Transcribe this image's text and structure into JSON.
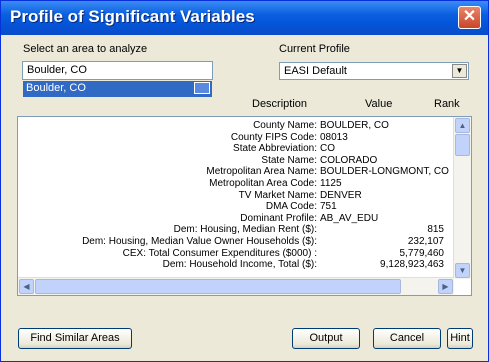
{
  "window": {
    "title": "Profile of Significant Variables"
  },
  "area": {
    "label": "Select an area to analyze",
    "input_value": "Boulder, CO",
    "selected_item": "Boulder, CO"
  },
  "profile": {
    "label": "Current Profile",
    "selected": "EASI Default"
  },
  "table": {
    "headers": {
      "description": "Description",
      "value": "Value",
      "rank": "Rank"
    },
    "rows": [
      {
        "description": "County Name:",
        "value": "BOULDER, CO"
      },
      {
        "description": "County FIPS Code:",
        "value": "08013"
      },
      {
        "description": "State Abbreviation:",
        "value": "CO"
      },
      {
        "description": "State Name:",
        "value": "COLORADO"
      },
      {
        "description": "Metropolitan Area Name:",
        "value": "BOULDER-LONGMONT, CO"
      },
      {
        "description": "Metropolitan Area Code:",
        "value": "1125"
      },
      {
        "description": "TV Market Name:",
        "value": "DENVER"
      },
      {
        "description": "DMA Code:",
        "value": "751"
      },
      {
        "description": "Dominant Profile:",
        "value": "AB_AV_EDU"
      },
      {
        "description": "Dem: Housing, Median Rent ($):",
        "value": "815"
      },
      {
        "description": "Dem: Housing, Median Value Owner Households ($):",
        "value": "232,107"
      },
      {
        "description": "CEX: Total Consumer Expenditures ($000) :",
        "value": "5,779,460"
      },
      {
        "description": "Dem: Household Income, Total ($):",
        "value": "9,128,923,463"
      }
    ]
  },
  "buttons": {
    "find_similar": "Find Similar Areas",
    "output": "Output",
    "cancel": "Cancel",
    "hint": "Hint"
  },
  "icons": {
    "close": "close-icon",
    "dropdown": "chevron-down-icon",
    "scroll_up": "arrow-up-icon",
    "scroll_down": "arrow-down-icon",
    "scroll_left": "arrow-left-icon",
    "scroll_right": "arrow-right-icon"
  }
}
